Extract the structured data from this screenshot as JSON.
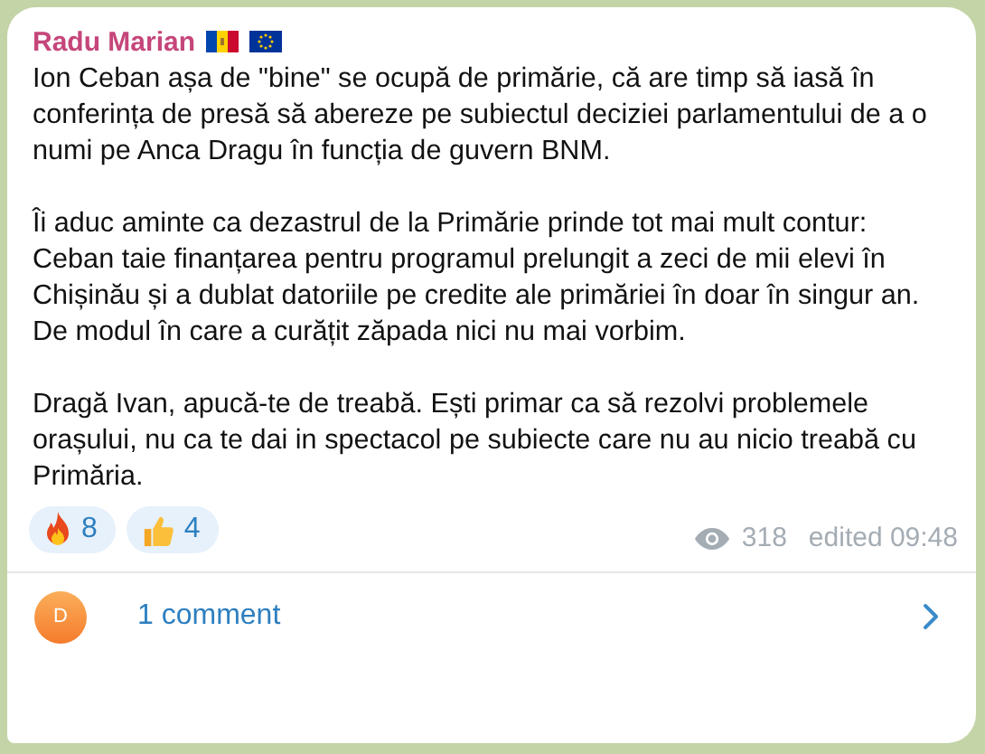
{
  "post": {
    "author": "Radu Marian",
    "paragraphs": [
      "Ion Ceban așa de \"bine\" se ocupă de primărie, că are timp să iasă în conferința de presă să abereze pe subiectul deciziei parlamentului de a o numi pe Anca Dragu în funcția de guvern BNM.",
      "Îi aduc aminte ca dezastrul de la Primărie prinde tot mai mult contur: Ceban taie finanțarea pentru programul prelungit a zeci de mii elevi în Chișinău și a dublat datoriile pe credite ale primăriei în doar în singur an. De modul în care a curățit zăpada nici nu mai vorbim.",
      "Dragă Ivan, apucă-te de treabă. Ești primar ca să rezolvi problemele orașului, nu ca te dai in spectacol pe subiecte care nu au nicio treabă cu Primăria."
    ],
    "reactions": [
      {
        "kind": "fire",
        "count": "8"
      },
      {
        "kind": "thumbs-up",
        "count": "4"
      }
    ],
    "views": "318",
    "time": "edited 09:48",
    "comments": {
      "avatar_letter": "D",
      "label": "1 comment"
    }
  }
}
